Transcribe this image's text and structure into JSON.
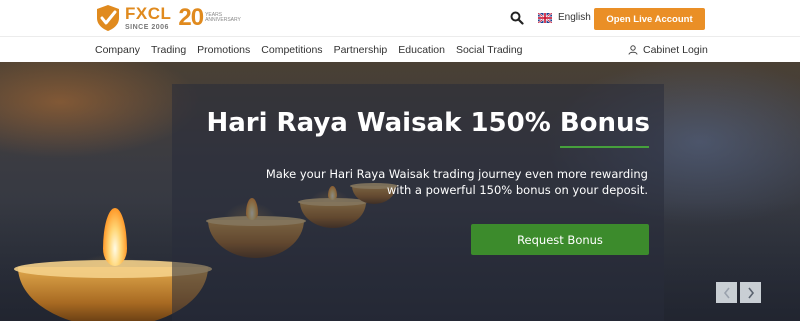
{
  "header": {
    "logo_name": "FXCL",
    "logo_since": "SINCE 2006",
    "anniversary_number": "20",
    "anniversary_line1": "YEARS",
    "anniversary_line2": "ANNIVERSARY",
    "language_label": "English",
    "open_account_label": "Open Live Account"
  },
  "nav": {
    "items": [
      {
        "label": "Company"
      },
      {
        "label": "Trading"
      },
      {
        "label": "Promotions"
      },
      {
        "label": "Competitions"
      },
      {
        "label": "Partnership"
      },
      {
        "label": "Education"
      },
      {
        "label": "Social Trading"
      }
    ],
    "cabinet_label": "Cabinet Login"
  },
  "hero": {
    "title": "Hari Raya Waisak 150% Bonus",
    "subtitle_line1": "Make your Hari Raya Waisak trading journey even more rewarding",
    "subtitle_line2": "with a powerful 150% bonus on your deposit.",
    "cta_label": "Request Bonus",
    "prev_symbol": "‹",
    "next_symbol": "›"
  },
  "icons": {
    "search": "search-icon",
    "flag": "uk-flag-icon",
    "user": "user-icon",
    "logo": "fxcl-shield-logo-icon"
  },
  "colors": {
    "brand_orange": "#ea8f26",
    "cta_green": "#3c8b2c",
    "underline_green": "#46a03c"
  }
}
